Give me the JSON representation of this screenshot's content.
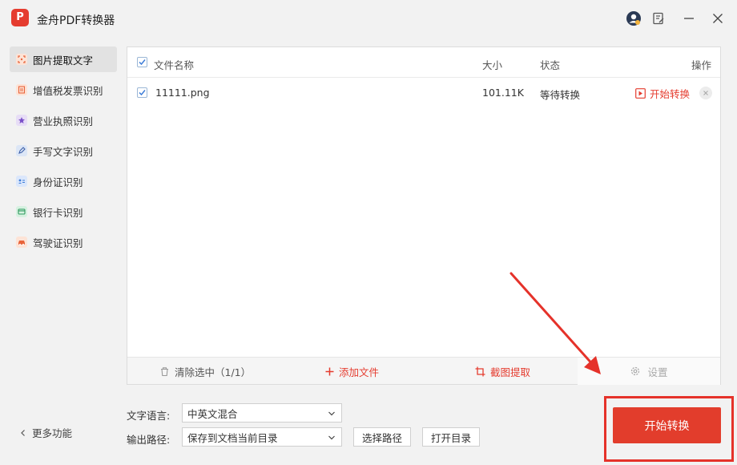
{
  "app": {
    "title": "金舟PDF转换器",
    "logo_text": "P"
  },
  "titlebar": {
    "icons": [
      "account-icon",
      "feedback-icon",
      "minimize-icon",
      "close-icon"
    ]
  },
  "sidebar": {
    "items": [
      {
        "label": "图片提取文字",
        "icon": "image-text-icon",
        "active": true
      },
      {
        "label": "增值税发票识别",
        "icon": "invoice-icon"
      },
      {
        "label": "营业执照识别",
        "icon": "license-icon"
      },
      {
        "label": "手写文字识别",
        "icon": "pen-icon"
      },
      {
        "label": "身份证识别",
        "icon": "id-card-icon"
      },
      {
        "label": "银行卡识别",
        "icon": "bank-card-icon"
      },
      {
        "label": "驾驶证识别",
        "icon": "car-icon"
      }
    ],
    "more_label": "更多功能"
  },
  "table": {
    "headers": {
      "name": "文件名称",
      "size": "大小",
      "status": "状态",
      "action": "操作"
    },
    "rows": [
      {
        "name": "11111.png",
        "size": "101.11K",
        "status": "等待转换",
        "action": "开始转换",
        "checked": true
      }
    ]
  },
  "toolbar": {
    "clear_label": "清除选中（1/1）",
    "add_label": "添加文件",
    "crop_label": "截图提取",
    "settings_label": "设置"
  },
  "options": {
    "language_label": "文字语言:",
    "language_value": "中英文混合",
    "output_label": "输出路径:",
    "output_value": "保存到文档当前目录",
    "choose_path_label": "选择路径",
    "open_dir_label": "打开目录"
  },
  "start_button": {
    "label": "开始转换"
  },
  "colors": {
    "accent": "#e23d2c",
    "arrow": "#e5322a",
    "checkbox": "#3d7dd8"
  }
}
